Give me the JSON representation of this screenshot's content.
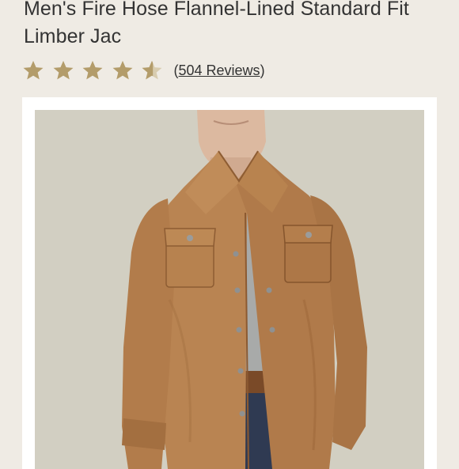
{
  "product": {
    "title": "Men's Fire Hose Flannel-Lined Standard Fit Limber Jac",
    "rating": 4.5,
    "rating_max": 5,
    "reviews_open": "(",
    "reviews_text": "504 Reviews",
    "reviews_close": ")",
    "image_subject": "man-wearing-tan-canvas-jacket"
  },
  "colors": {
    "background": "#efebe4",
    "star": "#b39c6a",
    "jacket": "#b98452",
    "photo_backdrop": "#d5d2c5"
  }
}
